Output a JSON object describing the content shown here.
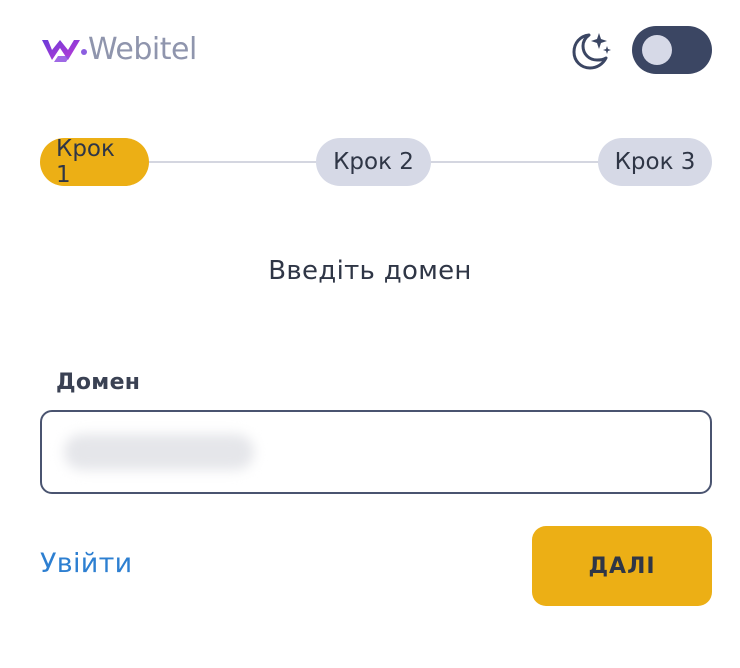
{
  "header": {
    "logo_text": "Webitel",
    "logo_icon": "webitel-logo-icon",
    "theme_icon": "moon-stars-icon",
    "dark_mode_on": true
  },
  "stepper": {
    "steps": [
      {
        "label": "Крок 1",
        "active": true
      },
      {
        "label": "Крок 2",
        "active": false
      },
      {
        "label": "Крок 3",
        "active": false
      }
    ]
  },
  "main": {
    "title": "Введіть домен",
    "domain_field": {
      "label": "Домен",
      "value": "",
      "placeholder": ""
    }
  },
  "actions": {
    "login_link": "Увійти",
    "next_button": "ДАЛІ"
  },
  "colors": {
    "accent": "#ecaf15",
    "link": "#2d7fd1",
    "toggle_bg": "#3b4663",
    "step_inactive": "#d6d9e6"
  }
}
